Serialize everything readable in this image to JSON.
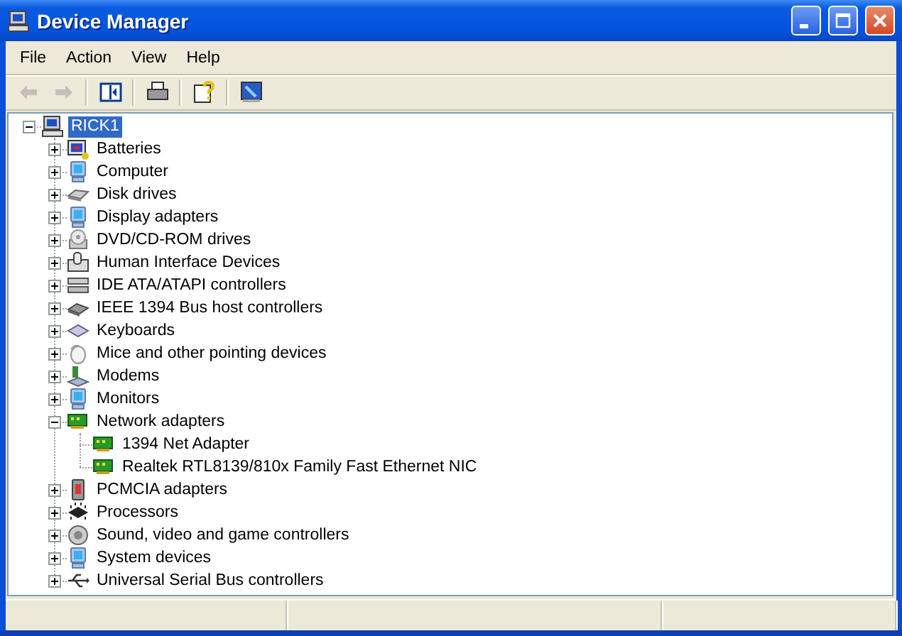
{
  "window": {
    "title": "Device Manager"
  },
  "menu": [
    "File",
    "Action",
    "View",
    "Help"
  ],
  "toolbar": [
    {
      "kind": "back",
      "disabled": true
    },
    {
      "kind": "forward",
      "disabled": true
    },
    {
      "kind": "separator"
    },
    {
      "kind": "panel",
      "disabled": false
    },
    {
      "kind": "separator"
    },
    {
      "kind": "print",
      "disabled": false
    },
    {
      "kind": "separator"
    },
    {
      "kind": "help",
      "disabled": false
    },
    {
      "kind": "separator"
    },
    {
      "kind": "properties",
      "disabled": false
    }
  ],
  "tree": [
    {
      "label": "RICK1",
      "kind": "computer",
      "expanded": true,
      "selected": true,
      "children": [
        {
          "label": "Batteries",
          "kind": "battery",
          "expanded": false,
          "selected": false
        },
        {
          "label": "Computer",
          "kind": "monitor",
          "expanded": false,
          "selected": false
        },
        {
          "label": "Disk drives",
          "kind": "disk",
          "expanded": false,
          "selected": false
        },
        {
          "label": "Display adapters",
          "kind": "monitor",
          "expanded": false,
          "selected": false
        },
        {
          "label": "DVD/CD-ROM drives",
          "kind": "cd",
          "expanded": false,
          "selected": false
        },
        {
          "label": "Human Interface Devices",
          "kind": "hid",
          "expanded": false,
          "selected": false
        },
        {
          "label": "IDE ATA/ATAPI controllers",
          "kind": "ide",
          "expanded": false,
          "selected": false
        },
        {
          "label": "IEEE 1394 Bus host controllers",
          "kind": "chip",
          "expanded": false,
          "selected": false
        },
        {
          "label": "Keyboards",
          "kind": "keyboard",
          "expanded": false,
          "selected": false
        },
        {
          "label": "Mice and other pointing devices",
          "kind": "mouse",
          "expanded": false,
          "selected": false
        },
        {
          "label": "Modems",
          "kind": "modem",
          "expanded": false,
          "selected": false
        },
        {
          "label": "Monitors",
          "kind": "monitor",
          "expanded": false,
          "selected": false
        },
        {
          "label": "Network adapters",
          "kind": "network",
          "expanded": true,
          "selected": false,
          "children": [
            {
              "label": "1394 Net Adapter",
              "kind": "network",
              "selected": false
            },
            {
              "label": "Realtek RTL8139/810x Family Fast Ethernet NIC",
              "kind": "network",
              "selected": false
            }
          ]
        },
        {
          "label": "PCMCIA adapters",
          "kind": "pcmcia",
          "expanded": false,
          "selected": false
        },
        {
          "label": "Processors",
          "kind": "cpu",
          "expanded": false,
          "selected": false
        },
        {
          "label": "Sound, video and game controllers",
          "kind": "sound",
          "expanded": false,
          "selected": false
        },
        {
          "label": "System devices",
          "kind": "monitor",
          "expanded": false,
          "selected": false
        },
        {
          "label": "Universal Serial Bus controllers",
          "kind": "usb",
          "expanded": false,
          "selected": false
        }
      ]
    }
  ]
}
